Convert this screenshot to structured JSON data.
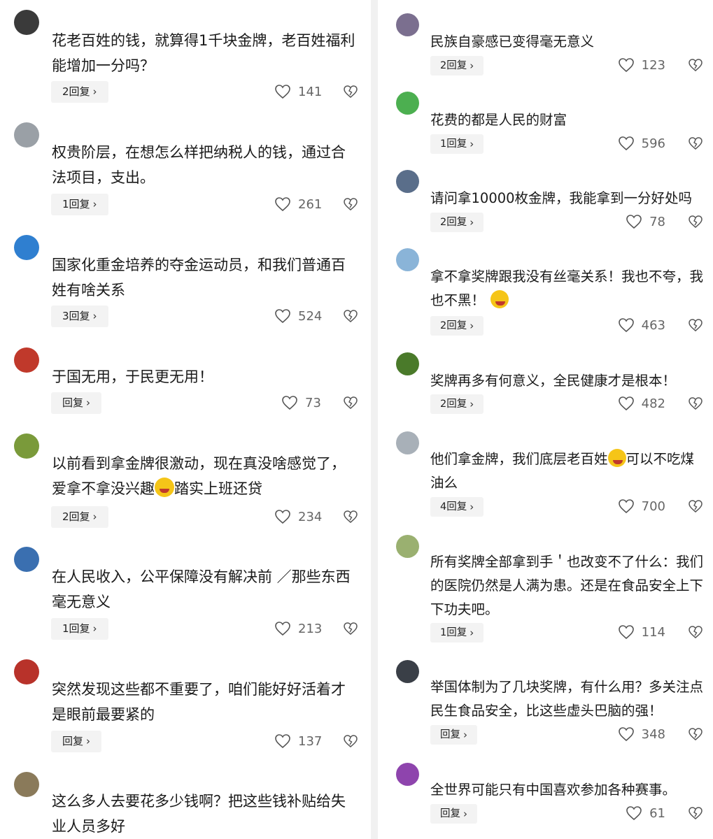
{
  "colors": {
    "text": "#1a1a1a",
    "muted": "#666666",
    "reply_bg": "#f3f3f3",
    "divider": "#f1f1f1"
  },
  "icons": {
    "like": "heart-outline-icon",
    "dislike": "broken-heart-icon",
    "reply_arrow": "chevron-right-icon"
  },
  "left_comments": [
    {
      "text": "花老百姓的钱，就算得1千块金牌，老百姓福利能增加一分吗？",
      "reply": "2回复",
      "likes": "141",
      "avatar_color": "#3a3a3a"
    },
    {
      "text": "权贵阶层，在想怎么样把纳税人的钱，通过合法项目，支出。",
      "reply": "1回复",
      "likes": "261",
      "avatar_color": "#9aa0a6"
    },
    {
      "text": "国家化重金培养的夺金运动员，和我们普通百姓有啥关系",
      "reply": "3回复",
      "likes": "524",
      "avatar_color": "#2f7fd0"
    },
    {
      "text": "于国无用，于民更无用！",
      "reply": "回复",
      "likes": "73",
      "avatar_color": "#c0392b"
    },
    {
      "text": "以前看到拿金牌很激动，现在真没啥感觉了，爱拿不拿没兴趣",
      "text_after": "踏实上班还贷",
      "reply": "2回复",
      "likes": "234",
      "avatar_color": "#7a9a3a"
    },
    {
      "text": "在人民收入，公平保障没有解决前 ／那些东西毫无意义",
      "reply": "1回复",
      "likes": "213",
      "avatar_color": "#3a6fb0"
    },
    {
      "text": "突然发现这些都不重要了，咱们能好好活着才是眼前最要紧的",
      "reply": "回复",
      "likes": "137",
      "avatar_color": "#b8322a"
    },
    {
      "text": "这么多人去要花多少钱啊？把这些钱补贴给失业人员多好",
      "avatar_color": "#8a7a5a"
    }
  ],
  "right_comments": [
    {
      "text": "民族自豪感已变得毫无意义",
      "reply": "2回复",
      "likes": "123",
      "avatar_color": "#7b6f8f"
    },
    {
      "text": "花费的都是人民的财富",
      "reply": "1回复",
      "likes": "596",
      "avatar_color": "#4caf50"
    },
    {
      "text": "请问拿10000枚金牌，我能拿到一分好处吗",
      "reply": "2回复",
      "likes": "78",
      "avatar_color": "#5a6e8a"
    },
    {
      "text": "拿不拿奖牌跟我没有丝毫关系！我也不夸，我也不黑！",
      "reply": "2回复",
      "likes": "463",
      "avatar_color": "#8ab4d8"
    },
    {
      "text": "奖牌再多有何意义，全民健康才是根本！",
      "reply": "2回复",
      "likes": "482",
      "avatar_color": "#4a7a2a"
    },
    {
      "text": "他们拿金牌，我们底层老百姓",
      "text_after": "可以不吃煤油么",
      "reply": "4回复",
      "likes": "700",
      "avatar_color": "#a8b0b8"
    },
    {
      "text": "所有奖牌全部拿到手＇也改变不了什么：我们的医院仍然是人满为患。还是在食品安全上下下功夫吧。",
      "reply": "1回复",
      "likes": "114",
      "avatar_color": "#9ab070"
    },
    {
      "text": "举国体制为了几块奖牌，有什么用？多关注点民生食品安全，比这些虚头巴脑的强！",
      "reply": "回复",
      "likes": "348",
      "avatar_color": "#3a3f47"
    },
    {
      "text": "全世界可能只有中国喜欢参加各种赛事。",
      "reply": "回复",
      "likes": "61",
      "avatar_color": "#8e44ad"
    }
  ]
}
